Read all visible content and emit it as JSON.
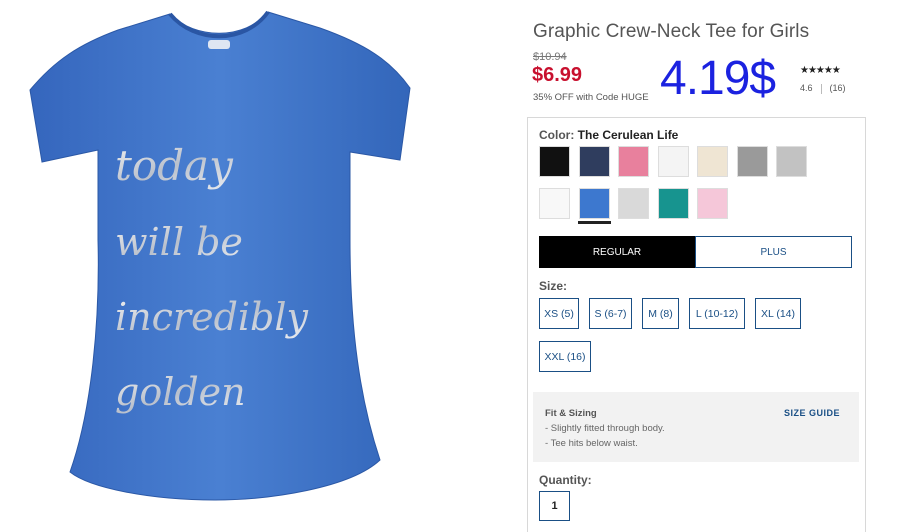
{
  "product": {
    "title": "Graphic Crew-Neck Tee for Girls",
    "image_alt": "Blue graphic tee with metallic script",
    "shirt_text": [
      "today",
      "will be",
      "incredibly",
      "golden"
    ],
    "shirt_color": "#3f73c9"
  },
  "pricing": {
    "original_price": "$10.94",
    "sale_price": "$6.99",
    "promo_text": "35% OFF with Code HUGE",
    "overlay_price": "4.19$"
  },
  "rating": {
    "stars": "★★★★★",
    "score": "4.6",
    "count": "(16)"
  },
  "color": {
    "label": "Color:",
    "value": "The Cerulean Life",
    "swatches": [
      {
        "name": "black",
        "hex": "#111111"
      },
      {
        "name": "navy-heather",
        "hex": "#2f3d5e"
      },
      {
        "name": "pink",
        "hex": "#e8809d"
      },
      {
        "name": "white-print",
        "hex": "#f4f4f4"
      },
      {
        "name": "cream",
        "hex": "#efe5d3"
      },
      {
        "name": "gray-print",
        "hex": "#9a9a9a"
      },
      {
        "name": "light-heather-gray",
        "hex": "#c2c2c2"
      },
      {
        "name": "white",
        "hex": "#f8f8f8"
      },
      {
        "name": "cerulean",
        "hex": "#3d78cf"
      },
      {
        "name": "light-gray",
        "hex": "#d9d9d9"
      },
      {
        "name": "teal",
        "hex": "#17948f"
      },
      {
        "name": "light-pink",
        "hex": "#f5c7d9"
      }
    ],
    "selected_index": 8
  },
  "fit": {
    "regular_label": "REGULAR",
    "plus_label": "PLUS"
  },
  "size": {
    "label": "Size:",
    "options": [
      "XS (5)",
      "S (6-7)",
      "M (8)",
      "L (10-12)",
      "XL (14)",
      "XXL (16)"
    ]
  },
  "fit_sizing": {
    "title": "Fit & Sizing",
    "size_guide_label": "SIZE GUIDE",
    "lines": [
      "- Slightly fitted through body.",
      "- Tee hits below waist."
    ]
  },
  "quantity": {
    "label": "Quantity:",
    "value": "1"
  },
  "colors": {
    "accent_blue": "#1a4f85",
    "sale_red": "#c8102e",
    "overlay_blue": "#1b22e0"
  }
}
